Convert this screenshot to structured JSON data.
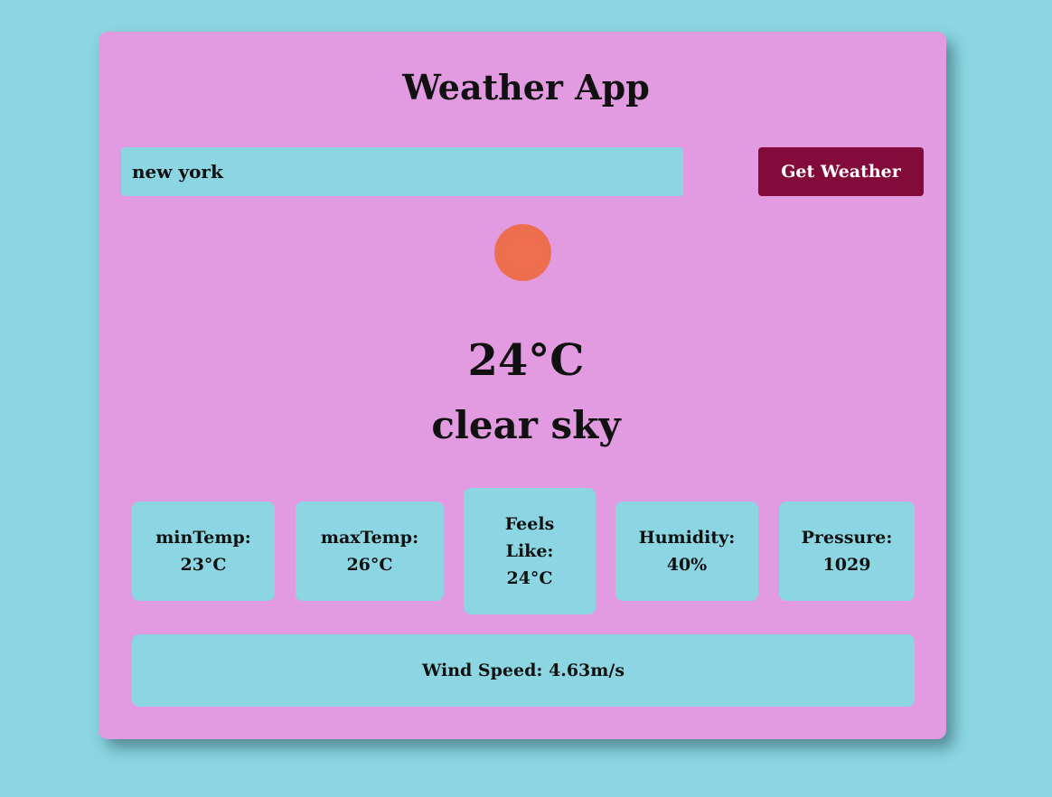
{
  "app": {
    "title": "Weather App"
  },
  "search": {
    "value": "new york",
    "button_label": "Get Weather"
  },
  "weather": {
    "icon": "sun-icon",
    "temperature": "24°C",
    "description": "clear sky"
  },
  "stats": [
    {
      "label": "minTemp:",
      "value": "23°C"
    },
    {
      "label": "maxTemp:",
      "value": "26°C"
    },
    {
      "label": "Feels Like:",
      "value": "24°C"
    },
    {
      "label": "Humidity:",
      "value": "40%"
    },
    {
      "label": "Pressure:",
      "value": "1029"
    }
  ],
  "wind": {
    "text": "Wind Speed: 4.63m/s"
  },
  "colors": {
    "page_background": "#8bd6e2",
    "card_background": "#e29be1",
    "button_background": "#830b3a",
    "sun": "#ec6e4e"
  }
}
